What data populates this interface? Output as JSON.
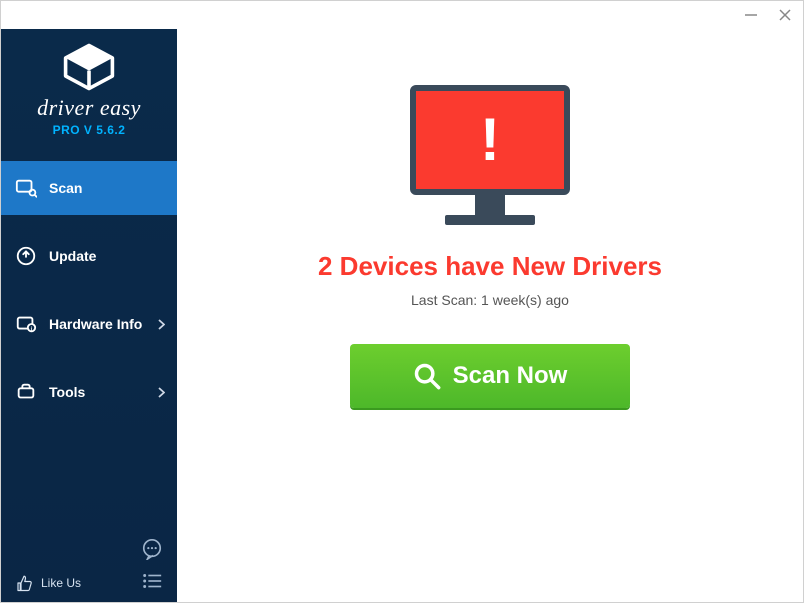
{
  "titlebar": {
    "minimize": "—",
    "close": "✕"
  },
  "brand": {
    "name": "driver easy",
    "version": "PRO V 5.6.2"
  },
  "nav": {
    "scan": "Scan",
    "update": "Update",
    "hardware": "Hardware Info",
    "tools": "Tools"
  },
  "footer": {
    "likeus": "Like Us"
  },
  "main": {
    "headline": "2 Devices have New Drivers",
    "last_scan": "Last Scan: 1 week(s) ago",
    "scan_button": "Scan Now",
    "alert_glyph": "!"
  },
  "colors": {
    "accent": "#1e78c8",
    "sidebar_bg": "#0a2a4a",
    "alert_red": "#fb3a2f",
    "scan_green": "#5cc32c"
  }
}
